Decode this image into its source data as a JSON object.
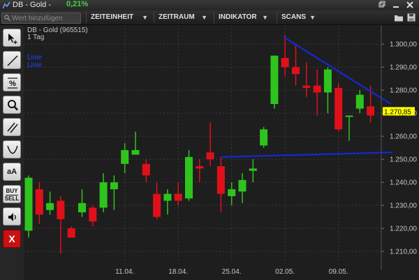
{
  "window": {
    "title": "DB - Gold -",
    "change": "0,21%"
  },
  "toolbar": {
    "search_placeholder": "Wert hinzufügen",
    "menus": [
      "ZEITEINHEIT",
      "ZEITRAUM",
      "INDIKATOR",
      "SCANS"
    ]
  },
  "sidebar": {
    "tools": [
      "select-add-tool",
      "line-tool",
      "percent-tool",
      "zoom-tool",
      "parallel-lines-tool",
      "curve-tool"
    ],
    "text_tool_label": "aA",
    "buy_label": "BUY",
    "sell_label": "SELL",
    "close_label": "X"
  },
  "chart_header": {
    "instrument": "DB - Gold (965515)",
    "interval": "1 Tag",
    "legend": [
      "Linie",
      "Linie"
    ]
  },
  "colors": {
    "up": "#2ec41d",
    "down": "#e0101a",
    "trendline": "#1428d6",
    "price_tag": "#ffff00",
    "background": "#1e1e1e",
    "grid": "#3a3a3a"
  },
  "chart_data": {
    "type": "candlestick",
    "y_ticks": [
      "1.300,00",
      "1.290,00",
      "1.280,00",
      "1.270,00",
      "1.260,00",
      "1.250,00",
      "1.240,00",
      "1.230,00",
      "1.220,00",
      "1.210,00"
    ],
    "ylim": [
      1207,
      1304
    ],
    "x_ticks": [
      {
        "label": "11.04.",
        "index": 9
      },
      {
        "label": "18.04.",
        "index": 14
      },
      {
        "label": "25.04.",
        "index": 19
      },
      {
        "label": "02.05.",
        "index": 24
      },
      {
        "label": "09.05.",
        "index": 29
      }
    ],
    "last_price": "1.270,85",
    "last_value": 1270.85,
    "candles": [
      {
        "o": 1219,
        "h": 1243,
        "l": 1216,
        "c": 1242
      },
      {
        "o": 1237,
        "h": 1240,
        "l": 1222,
        "c": 1226
      },
      {
        "o": 1228,
        "h": 1236,
        "l": 1226,
        "c": 1231
      },
      {
        "o": 1232,
        "h": 1234,
        "l": 1209,
        "c": 1224
      },
      {
        "o": 1220,
        "h": 1221,
        "l": 1217,
        "c": 1216
      },
      {
        "o": 1227,
        "h": 1237,
        "l": 1225,
        "c": 1231
      },
      {
        "o": 1229,
        "h": 1230,
        "l": 1221,
        "c": 1223
      },
      {
        "o": 1229,
        "h": 1244,
        "l": 1227,
        "c": 1240
      },
      {
        "o": 1237,
        "h": 1243,
        "l": 1228,
        "c": 1240
      },
      {
        "o": 1248,
        "h": 1257,
        "l": 1244,
        "c": 1254
      },
      {
        "o": 1252,
        "h": 1262,
        "l": 1252,
        "c": 1254
      },
      {
        "o": 1248,
        "h": 1250,
        "l": 1240,
        "c": 1243
      },
      {
        "o": 1235,
        "h": 1240,
        "l": 1224,
        "c": 1225
      },
      {
        "o": 1232,
        "h": 1237,
        "l": 1226,
        "c": 1235
      },
      {
        "o": 1235,
        "h": 1240,
        "l": 1230,
        "c": 1232
      },
      {
        "o": 1233,
        "h": 1254,
        "l": 1232,
        "c": 1251
      },
      {
        "o": 1247,
        "h": 1250,
        "l": 1240,
        "c": 1246
      },
      {
        "o": 1253,
        "h": 1266,
        "l": 1247,
        "c": 1250
      },
      {
        "o": 1247,
        "h": 1251,
        "l": 1227,
        "c": 1235
      },
      {
        "o": 1234,
        "h": 1240,
        "l": 1230,
        "c": 1237
      },
      {
        "o": 1236,
        "h": 1244,
        "l": 1231,
        "c": 1241
      },
      {
        "o": 1245,
        "h": 1250,
        "l": 1240,
        "c": 1246
      },
      {
        "o": 1256,
        "h": 1264,
        "l": 1255,
        "c": 1263
      },
      {
        "o": 1274,
        "h": 1295,
        "l": 1272,
        "c": 1295
      },
      {
        "o": 1294,
        "h": 1304,
        "l": 1286,
        "c": 1290
      },
      {
        "o": 1290,
        "h": 1300,
        "l": 1282,
        "c": 1287
      },
      {
        "o": 1282,
        "h": 1292,
        "l": 1277,
        "c": 1281
      },
      {
        "o": 1282,
        "h": 1289,
        "l": 1269,
        "c": 1279
      },
      {
        "o": 1279,
        "h": 1290,
        "l": 1270,
        "c": 1289
      },
      {
        "o": 1281,
        "h": 1283,
        "l": 1262,
        "c": 1263
      },
      {
        "o": 1269,
        "h": 1269,
        "l": 1258,
        "c": 1269
      },
      {
        "o": 1272,
        "h": 1280,
        "l": 1270,
        "c": 1278
      },
      {
        "o": 1273,
        "h": 1282,
        "l": 1266,
        "c": 1269
      }
    ],
    "trendlines": [
      {
        "name": "Linie",
        "x1": 23.9,
        "y1": 1303,
        "x2": 33.9,
        "y2": 1274
      },
      {
        "name": "Linie",
        "x1": 18,
        "y1": 1251,
        "x2": 34,
        "y2": 1253
      }
    ]
  }
}
